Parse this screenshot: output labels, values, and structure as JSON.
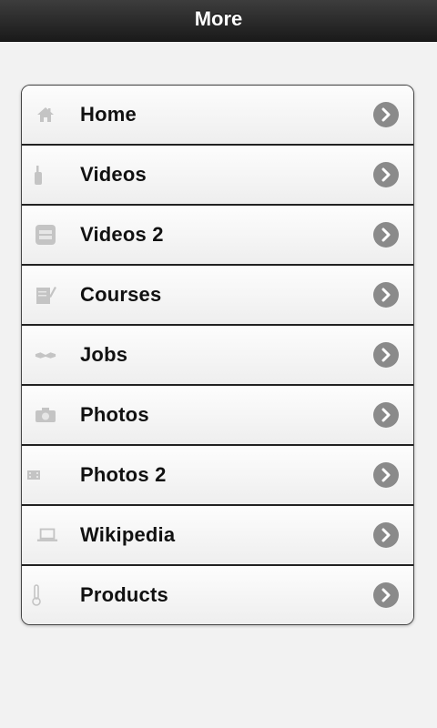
{
  "header": {
    "title": "More"
  },
  "menu": {
    "items": [
      {
        "label": "Home",
        "icon": "home-icon"
      },
      {
        "label": "Videos",
        "icon": "video-camera-icon"
      },
      {
        "label": "Videos 2",
        "icon": "youtube-icon"
      },
      {
        "label": "Courses",
        "icon": "notebook-pencil-icon"
      },
      {
        "label": "Jobs",
        "icon": "handshake-icon"
      },
      {
        "label": "Photos",
        "icon": "camera-icon"
      },
      {
        "label": "Photos 2",
        "icon": "film-icon"
      },
      {
        "label": "Wikipedia",
        "icon": "laptop-icon"
      },
      {
        "label": "Products",
        "icon": "thermometer-icon"
      }
    ]
  },
  "colors": {
    "header_bg": "#2a2a2a",
    "page_bg": "#f2f2f2",
    "arrow_bg": "#8a8a8a",
    "icon_gray": "#c4c4c4"
  }
}
